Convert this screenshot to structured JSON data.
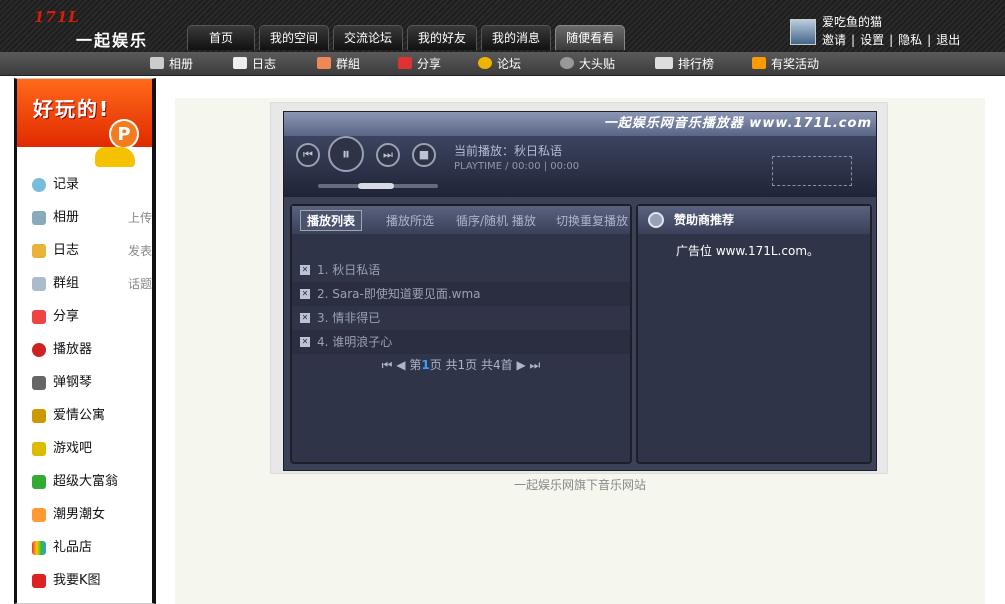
{
  "logo": {
    "brand": "171L",
    "name": "一起娱乐"
  },
  "nav": {
    "tabs": [
      {
        "label": "首页"
      },
      {
        "label": "我的空间"
      },
      {
        "label": "交流论坛"
      },
      {
        "label": "我的好友"
      },
      {
        "label": "我的消息"
      },
      {
        "label": "随便看看"
      }
    ]
  },
  "user": {
    "name": "爱吃鱼的猫",
    "links": [
      "邀请",
      "设置",
      "隐私",
      "退出"
    ]
  },
  "subnav": {
    "items": [
      {
        "label": "相册",
        "icon": "camera-icon"
      },
      {
        "label": "日志",
        "icon": "note-icon"
      },
      {
        "label": "群組",
        "icon": "group-icon"
      },
      {
        "label": "分享",
        "icon": "heart-icon"
      },
      {
        "label": "论坛",
        "icon": "forum-icon"
      },
      {
        "label": "大头贴",
        "icon": "photo-sticker-icon"
      },
      {
        "label": "排行榜",
        "icon": "pk-icon"
      },
      {
        "label": "有奖活动",
        "icon": "gift-icon"
      }
    ]
  },
  "sidebar": {
    "promo": "好玩的!",
    "promo_badge": "P",
    "items": [
      {
        "label": "记录",
        "extra": ""
      },
      {
        "label": "相册",
        "extra": "上传"
      },
      {
        "label": "日志",
        "extra": "发表"
      },
      {
        "label": "群组",
        "extra": "话题"
      },
      {
        "label": "分享",
        "extra": ""
      },
      {
        "label": "播放器",
        "extra": ""
      },
      {
        "label": "弹钢琴",
        "extra": ""
      },
      {
        "label": "爱情公寓",
        "extra": ""
      },
      {
        "label": "游戏吧",
        "extra": ""
      },
      {
        "label": "超级大富翁",
        "extra": ""
      },
      {
        "label": "潮男潮女",
        "extra": ""
      },
      {
        "label": "礼品店",
        "extra": ""
      },
      {
        "label": "我要K图",
        "extra": ""
      }
    ]
  },
  "player": {
    "title": "一起娱乐网音乐播放器 www.171L.com",
    "now_playing": "当前播放：秋日私语",
    "playtime": "PLAYTIME / 00:00 | 00:00",
    "tabs": [
      "播放列表",
      "播放所选",
      "循序/随机 播放",
      "切换重复播放"
    ],
    "tracks": [
      "1. 秋日私语",
      "2. Sara-即使知道要见面.wma",
      "3. 情非得已",
      "4. 谁明浪子心"
    ],
    "pager": {
      "before": "第",
      "page": "1",
      "after": "页 共1页 共4首"
    },
    "sponsor_title": "赞助商推荐",
    "sponsor_text": "广告位 www.171L.com。"
  },
  "footer": {
    "caption": "一起娱乐网旗下音乐网站"
  }
}
